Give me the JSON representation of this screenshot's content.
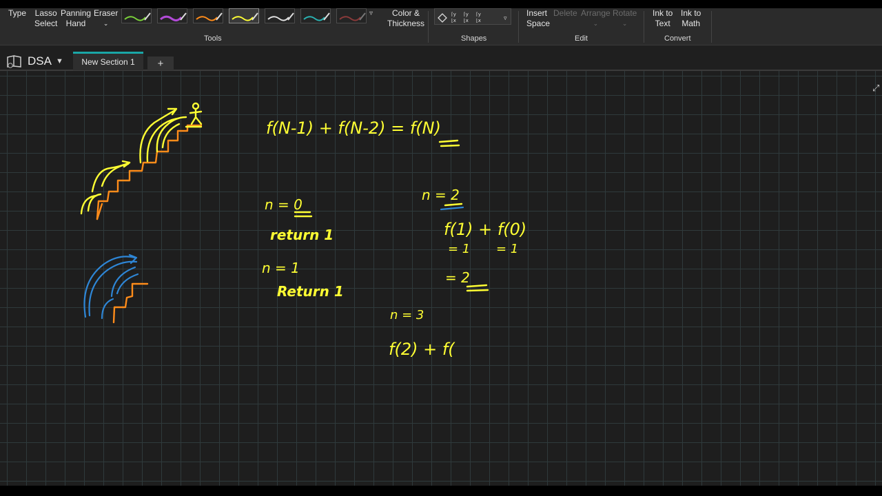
{
  "ribbon": {
    "tools": {
      "type_label": "Type",
      "lasso_label_1": "Lasso",
      "lasso_label_2": "Select",
      "panning_label_1": "Panning",
      "panning_label_2": "Hand",
      "eraser_label": "Eraser",
      "color_label_1": "Color &",
      "color_label_2": "Thickness",
      "group_label": "Tools",
      "pen_colors": [
        "#7bd23a",
        "#b14ad6",
        "#ff8c1a",
        "#ffff33",
        "#e0e0e0",
        "#2ab3b3",
        "#8a3a3a"
      ]
    },
    "shapes": {
      "group_label": "Shapes"
    },
    "edit": {
      "insert_label_1": "Insert",
      "insert_label_2": "Space",
      "delete_label": "Delete",
      "arrange_label": "Arrange",
      "rotate_label": "Rotate",
      "group_label": "Edit"
    },
    "convert": {
      "ink_text_1": "Ink to",
      "ink_text_2": "Text",
      "ink_math_1": "Ink to",
      "ink_math_2": "Math",
      "group_label": "Convert"
    }
  },
  "notebook": {
    "name": "DSA"
  },
  "tabs": {
    "active": "New Section 1",
    "add": "+"
  },
  "ink": {
    "equation": "f(N-1) + f(N-2) = f(N)",
    "n0": "n = 0",
    "return1a": "return 1",
    "n1": "n = 1",
    "return1b": "Return 1",
    "n2": "n = 2",
    "f1f0": "f(1) + f(0)",
    "eq1a": "= 1",
    "eq1b": "= 1",
    "eq2": "= 2",
    "n3": "n = 3",
    "f2": "f(2) + f("
  },
  "colors": {
    "accent": "#1aa6a6",
    "ink_yellow": "#ffff33",
    "ink_orange": "#ff8c1a",
    "ink_blue": "#2e86d6"
  }
}
